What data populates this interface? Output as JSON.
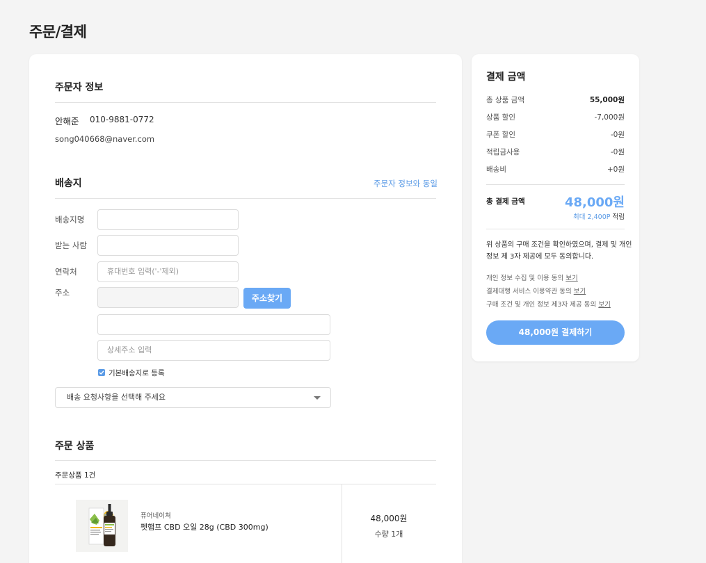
{
  "page": {
    "title": "주문/결제"
  },
  "orderer": {
    "title": "주문자 정보",
    "name": "안해준",
    "phone": "010-9881-0772",
    "email": "song040668@naver.com"
  },
  "shipping": {
    "title": "배송지",
    "same_as_orderer": "주문자 정보와 동일",
    "fields": {
      "name_label": "배송지명",
      "recipient_label": "받는 사람",
      "contact_label": "연락처",
      "contact_placeholder": "휴대번호 입력('-'제외)",
      "address_label": "주소",
      "find_address_button": "주소찾기",
      "detail_placeholder": "상세주소 입력"
    },
    "default_checkbox": {
      "label": "기본배송지로 등록",
      "checked": true
    },
    "request_select": {
      "value": "배송 요청사항을 선택해 주세요"
    }
  },
  "order_items": {
    "title": "주문 상품",
    "count_label": "주문상품 1건",
    "items": [
      {
        "brand": "퓨어네이쳐",
        "name": "펫햄프 CBD 오일 28g (CBD 300mg)",
        "price": "48,000원",
        "quantity": "수량 1개"
      }
    ]
  },
  "payment": {
    "title": "결제 금액",
    "rows": [
      {
        "label": "총 상품 금액",
        "value": "55,000원"
      },
      {
        "label": "상품 할인",
        "value": "-7,000원"
      },
      {
        "label": "쿠폰 할인",
        "value": "-0원"
      },
      {
        "label": "적립금사용",
        "value": "-0원"
      },
      {
        "label": "배송비",
        "value": "+0원"
      }
    ],
    "total_label": "총 결제 금액",
    "total_value": "48,000원",
    "points": {
      "amount": "최대 2,400P",
      "suffix": "적립"
    },
    "agreement_line1": "위 상품의 구매 조건을 확인하였으며, 결제 및 개인",
    "agreement_line2": "정보 제 3자 제공에 모두 동의합니다.",
    "policies": [
      {
        "text": "개인 정보 수집 및 이용 동의",
        "link": "보기"
      },
      {
        "text": "결제대행 서비스 이용약관 동의",
        "link": "보기"
      },
      {
        "text": "구매 조건 및 개인 정보 제3자 제공 동의",
        "link": "보기"
      }
    ],
    "pay_button": "48,000원 결제하기"
  },
  "colors": {
    "accent": "#6aa9f5",
    "link": "#5b9be6",
    "background": "#f4f4f4"
  }
}
